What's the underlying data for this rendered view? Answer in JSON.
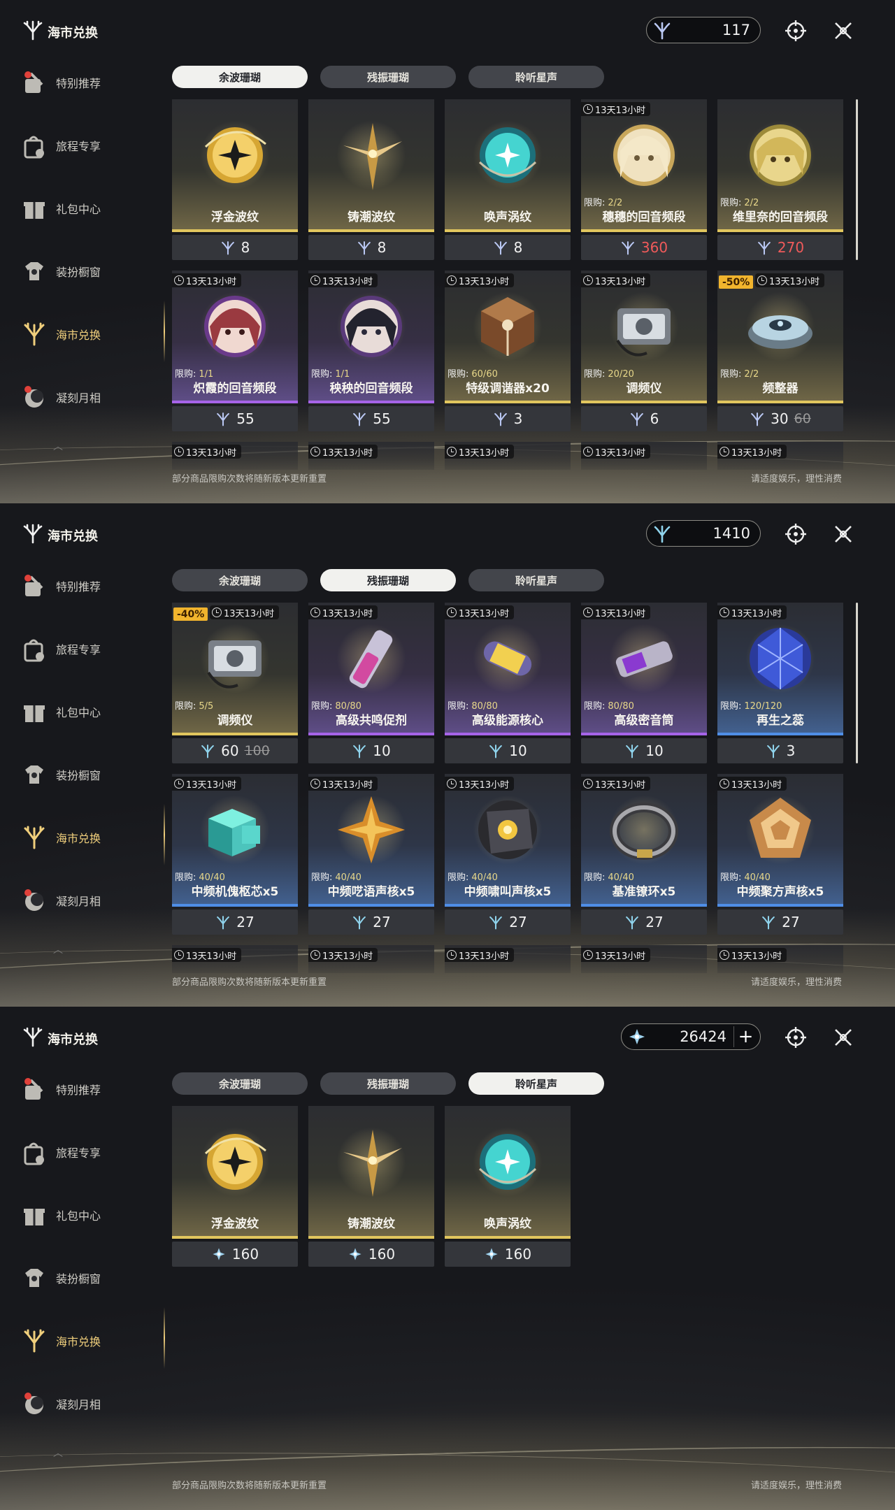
{
  "app": {
    "title": "海市兑换"
  },
  "sidebar": {
    "items": [
      {
        "label": "特别推荐",
        "icon": "featured-icon"
      },
      {
        "label": "旅程专享",
        "icon": "journey-bag-icon"
      },
      {
        "label": "礼包中心",
        "icon": "gift-icon"
      },
      {
        "label": "装扮橱窗",
        "icon": "outfit-icon"
      },
      {
        "label": "海市兑换",
        "icon": "coral-icon",
        "active": true
      },
      {
        "label": "凝刻月相",
        "icon": "moon-phase-icon"
      }
    ]
  },
  "tabs": [
    "余波珊瑚",
    "残振珊瑚",
    "聆听星声"
  ],
  "footer": {
    "left": "部分商品限购次数将随新版本更新重置",
    "right": "请适度娱乐，理性消费"
  },
  "colors": {
    "accent": "#f0cf7c",
    "gold_rarity": "#e1c65e",
    "purple_rarity": "#a664e8",
    "blue_rarity": "#4f8ee6",
    "discount": "#f1b42d",
    "red_price": "#f05a5a"
  },
  "screens": [
    {
      "active_tab": 0,
      "currency": {
        "value": "117",
        "icon": "afterglow-coral-icon"
      },
      "cards": [
        {
          "name": "浮金波纹",
          "price": "8",
          "rarity": "gold",
          "art": "gold-orb"
        },
        {
          "name": "铸潮波纹",
          "price": "8",
          "rarity": "gold",
          "art": "gold-blade"
        },
        {
          "name": "唤声涡纹",
          "price": "8",
          "rarity": "gold",
          "art": "cyan-orb"
        },
        {
          "name": "穗穗的回音频段",
          "price": "360",
          "red": true,
          "timer": "13天13小时",
          "limit_label": "限购:",
          "limit": "2/2",
          "rarity": "gold",
          "art": "portrait-blonde"
        },
        {
          "name": "维里奈的回音频段",
          "price": "270",
          "red": true,
          "limit_label": "限购:",
          "limit": "2/2",
          "rarity": "gold",
          "art": "portrait-green"
        },
        {
          "name": "炽霞的回音频段",
          "price": "55",
          "timer": "13天13小时",
          "limit_label": "限购:",
          "limit": "1/1",
          "rarity": "purple",
          "art": "portrait-red"
        },
        {
          "name": "秧秧的回音频段",
          "price": "55",
          "timer": "13天13小时",
          "limit_label": "限购:",
          "limit": "1/1",
          "rarity": "purple",
          "art": "portrait-dark"
        },
        {
          "name": "特级调谐器x20",
          "price": "3",
          "timer": "13天13小时",
          "limit_label": "限购:",
          "limit": "60/60",
          "rarity": "gold",
          "art": "tuner-cube"
        },
        {
          "name": "调频仪",
          "price": "6",
          "timer": "13天13小时",
          "limit_label": "限购:",
          "limit": "20/20",
          "rarity": "gold",
          "art": "device"
        },
        {
          "name": "频整器",
          "price": "30",
          "old_price": "60",
          "discount": "-50%",
          "timer": "13天13小时",
          "limit_label": "限购:",
          "limit": "2/2",
          "rarity": "gold",
          "art": "disc-device"
        }
      ],
      "ghost_timers": [
        "13天13小时",
        "13天13小时",
        "13天13小时",
        "13天13小时",
        "13天13小时"
      ]
    },
    {
      "active_tab": 1,
      "currency": {
        "value": "1410",
        "icon": "lingering-coral-icon"
      },
      "cards": [
        {
          "name": "调频仪",
          "price": "60",
          "old_price": "100",
          "discount": "-40%",
          "timer": "13天13小时",
          "limit_label": "限购:",
          "limit": "5/5",
          "rarity": "gold",
          "art": "device"
        },
        {
          "name": "高级共鸣促剂",
          "price": "10",
          "timer": "13天13小时",
          "limit_label": "限购:",
          "limit": "80/80",
          "rarity": "purple",
          "art": "vial"
        },
        {
          "name": "高级能源核心",
          "price": "10",
          "timer": "13天13小时",
          "limit_label": "限购:",
          "limit": "80/80",
          "rarity": "purple",
          "art": "capsule"
        },
        {
          "name": "高级密音筒",
          "price": "10",
          "timer": "13天13小时",
          "limit_label": "限购:",
          "limit": "80/80",
          "rarity": "purple",
          "art": "cylinder"
        },
        {
          "name": "再生之蕊",
          "price": "3",
          "timer": "13天13小时",
          "limit_label": "限购:",
          "limit": "120/120",
          "rarity": "blue",
          "art": "blue-crystal"
        },
        {
          "name": "中频机傀枢芯x5",
          "price": "27",
          "timer": "13天13小时",
          "limit_label": "限购:",
          "limit": "40/40",
          "rarity": "blue",
          "art": "cyan-cube"
        },
        {
          "name": "中频呓语声核x5",
          "price": "27",
          "timer": "13天13小时",
          "limit_label": "限购:",
          "limit": "40/40",
          "rarity": "blue",
          "art": "gold-star"
        },
        {
          "name": "中频啸叫声核x5",
          "price": "27",
          "timer": "13天13小时",
          "limit_label": "限购:",
          "limit": "40/40",
          "rarity": "blue",
          "art": "dark-core"
        },
        {
          "name": "基准镣环x5",
          "price": "27",
          "timer": "13天13小时",
          "limit_label": "限购:",
          "limit": "40/40",
          "rarity": "blue",
          "art": "ring"
        },
        {
          "name": "中频聚方声核x5",
          "price": "27",
          "timer": "13天13小时",
          "limit_label": "限购:",
          "limit": "40/40",
          "rarity": "blue",
          "art": "pentagon"
        }
      ],
      "ghost_timers": [
        "13天13小时",
        "13天13小时",
        "13天13小时",
        "13天13小时",
        "13天13小时"
      ]
    },
    {
      "active_tab": 2,
      "currency": {
        "value": "26424",
        "icon": "starsong-icon",
        "plus": "+"
      },
      "cards": [
        {
          "name": "浮金波纹",
          "price": "160",
          "rarity": "gold",
          "art": "gold-orb"
        },
        {
          "name": "铸潮波纹",
          "price": "160",
          "rarity": "gold",
          "art": "gold-blade"
        },
        {
          "name": "唤声涡纹",
          "price": "160",
          "rarity": "gold",
          "art": "cyan-orb"
        }
      ],
      "ghost_timers": []
    }
  ]
}
